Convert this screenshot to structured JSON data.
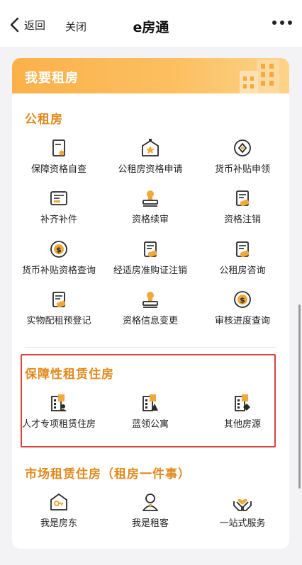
{
  "nav": {
    "back_label": "返回",
    "close_label": "关闭",
    "title": "e房通"
  },
  "card": {
    "header_title": "我要租房"
  },
  "sections": {
    "public": {
      "title": "公租房",
      "items": [
        {
          "label": "保障资格自查",
          "icon": "document-check-icon"
        },
        {
          "label": "公租房资格申请",
          "icon": "house-star-icon"
        },
        {
          "label": "货币补贴申领",
          "icon": "coin-diamond-icon"
        },
        {
          "label": "补齐补件",
          "icon": "id-card-icon"
        },
        {
          "label": "资格续审",
          "icon": "stamp-icon"
        },
        {
          "label": "资格注销",
          "icon": "certificate-icon"
        },
        {
          "label": "货币补贴资格查询",
          "icon": "dollar-coin-icon"
        },
        {
          "label": "经适房准购证注销",
          "icon": "certificate-icon"
        },
        {
          "label": "公租房咨询",
          "icon": "certificate-icon"
        },
        {
          "label": "实物配租预登记",
          "icon": "certificate-icon"
        },
        {
          "label": "资格信息变更",
          "icon": "stamp-icon"
        },
        {
          "label": "审核进度查询",
          "icon": "dollar-coin-icon"
        }
      ]
    },
    "affordable": {
      "title": "保障性租赁住房",
      "items": [
        {
          "label": "人才专项租赁住房",
          "icon": "building-user-icon"
        },
        {
          "label": "蓝领公寓",
          "icon": "building-warning-icon"
        },
        {
          "label": "其他房源",
          "icon": "building-diamond-icon"
        }
      ]
    },
    "market": {
      "title": "市场租赁住房（租房一件事）",
      "items": [
        {
          "label": "我是房东",
          "icon": "house-key-icon"
        },
        {
          "label": "我是租客",
          "icon": "person-icon"
        },
        {
          "label": "一站式服务",
          "icon": "hands-heart-icon"
        }
      ]
    }
  },
  "colors": {
    "accent": "#e08a1e",
    "header_gradient_start": "#fbb14a",
    "icon_dark": "#2a2a2a",
    "icon_orange": "#f0a838",
    "highlight_border": "#d9413c"
  }
}
